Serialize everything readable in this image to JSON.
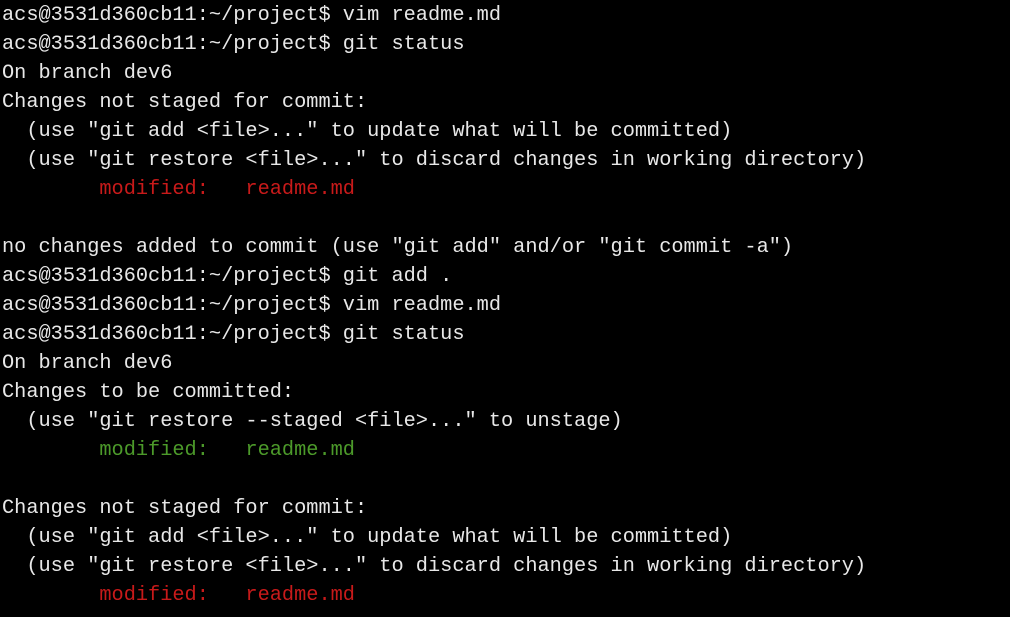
{
  "colors": {
    "background": "#000000",
    "text": "#e8e8e8",
    "unstaged": "#c81a1a",
    "staged": "#4c9a2a"
  },
  "terminal": {
    "lines": [
      "acs@3531d360cb11:~/project$ vim readme.md",
      "acs@3531d360cb11:~/project$ git status",
      "On branch dev6",
      "Changes not staged for commit:",
      "  (use \"git add <file>...\" to update what will be committed)",
      "  (use \"git restore <file>...\" to discard changes in working directory)",
      "        modified:   readme.md",
      "",
      "no changes added to commit (use \"git add\" and/or \"git commit -a\")",
      "acs@3531d360cb11:~/project$ git add .",
      "acs@3531d360cb11:~/project$ vim readme.md",
      "acs@3531d360cb11:~/project$ git status",
      "On branch dev6",
      "Changes to be committed:",
      "  (use \"git restore --staged <file>...\" to unstage)",
      "        modified:   readme.md",
      "",
      "Changes not staged for commit:",
      "  (use \"git add <file>...\" to update what will be committed)",
      "  (use \"git restore <file>...\" to discard changes in working directory)",
      "        modified:   readme.md"
    ]
  }
}
